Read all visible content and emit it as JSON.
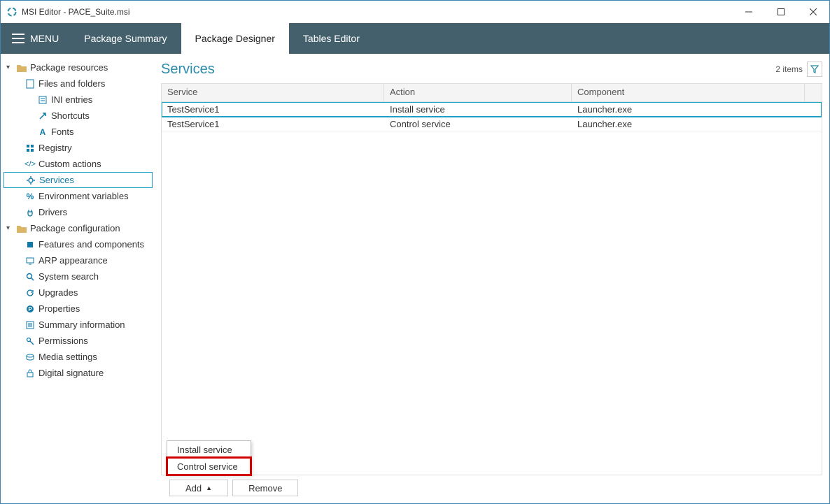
{
  "titlebar": {
    "title": "MSI Editor - PACE_Suite.msi"
  },
  "menubar": {
    "menu_label": "MENU",
    "tabs": [
      {
        "label": "Package Summary"
      },
      {
        "label": "Package Designer"
      },
      {
        "label": "Tables Editor"
      }
    ],
    "active_index": 1
  },
  "sidebar": {
    "groups": [
      {
        "label": "Package resources",
        "items": [
          {
            "label": "Files and folders",
            "icon": "file",
            "children": [
              {
                "label": "INI entries",
                "icon": "ini"
              },
              {
                "label": "Shortcuts",
                "icon": "shortcut"
              },
              {
                "label": "Fonts",
                "icon": "font"
              }
            ]
          },
          {
            "label": "Registry",
            "icon": "registry"
          },
          {
            "label": "Custom actions",
            "icon": "code"
          },
          {
            "label": "Services",
            "icon": "gear",
            "selected": true
          },
          {
            "label": "Environment variables",
            "icon": "percent"
          },
          {
            "label": "Drivers",
            "icon": "plug"
          }
        ]
      },
      {
        "label": "Package configuration",
        "items": [
          {
            "label": "Features and components",
            "icon": "puzzle"
          },
          {
            "label": "ARP appearance",
            "icon": "monitor"
          },
          {
            "label": "System search",
            "icon": "search"
          },
          {
            "label": "Upgrades",
            "icon": "refresh"
          },
          {
            "label": "Properties",
            "icon": "props"
          },
          {
            "label": "Summary information",
            "icon": "summary"
          },
          {
            "label": "Permissions",
            "icon": "key"
          },
          {
            "label": "Media settings",
            "icon": "media"
          },
          {
            "label": "Digital signature",
            "icon": "lock"
          }
        ]
      }
    ]
  },
  "main": {
    "title": "Services",
    "count_label": "2 items",
    "columns": [
      "Service",
      "Action",
      "Component"
    ],
    "rows": [
      {
        "service": "TestService1",
        "action": "Install service",
        "component": "Launcher.exe",
        "selected": true
      },
      {
        "service": "TestService1",
        "action": "Control service",
        "component": "Launcher.exe"
      }
    ]
  },
  "popup": {
    "items": [
      "Install service",
      "Control service"
    ],
    "highlight_index": 1
  },
  "buttons": {
    "add": "Add",
    "remove": "Remove"
  }
}
